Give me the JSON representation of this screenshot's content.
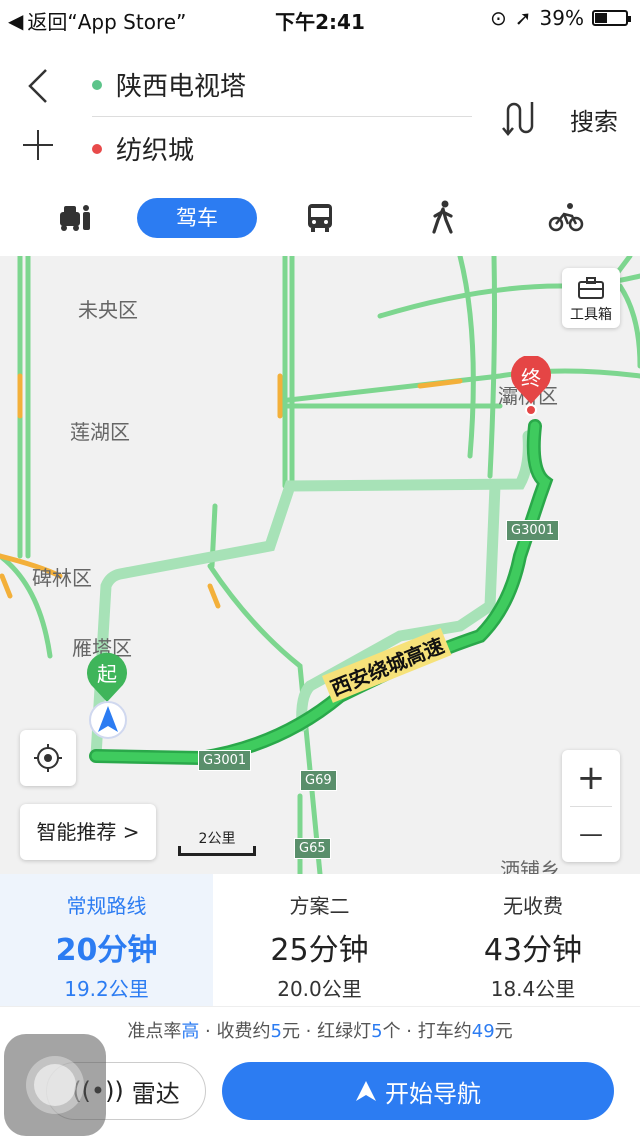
{
  "status_bar": {
    "back_label": "返回“App Store”",
    "time": "下午2:41",
    "battery": "39%",
    "battery_level": 0.39
  },
  "route": {
    "start": "陕西电视塔",
    "end": "纺织城",
    "search_label": "搜索",
    "start_color": "#5cc48a",
    "end_color": "#e84a4a"
  },
  "modes": {
    "taxi_icon": "taxi-icon",
    "drive_label": "驾车",
    "bus_icon": "bus-icon",
    "walk_icon": "walk-icon",
    "bike_icon": "bike-icon",
    "active_color": "#2c7cf2"
  },
  "map": {
    "districts": [
      "未央区",
      "莲湖区",
      "碑林区",
      "雁塔区",
      "灞桥区",
      "洒铺乡"
    ],
    "start_marker": "起",
    "end_marker": "终",
    "road_badges": [
      "G3001",
      "G3001",
      "G69",
      "G65"
    ],
    "highway_label": "西安绕城高速",
    "toolbox_label": "工具箱",
    "smart_label": "智能推荐 >",
    "scale_label": "2公里",
    "zoom_in": "+",
    "zoom_out": "—"
  },
  "routes": [
    {
      "name": "常规路线",
      "duration": "20分钟",
      "distance": "19.2公里"
    },
    {
      "name": "方案二",
      "duration": "25分钟",
      "distance": "20.0公里"
    },
    {
      "name": "无收费",
      "duration": "43分钟",
      "distance": "18.4公里"
    }
  ],
  "info": {
    "punctual_label": "准点率",
    "punctual_value": "高",
    "toll_label": " · 收费约",
    "toll_value": "5",
    "toll_unit": "元 · 红绿灯",
    "lights_value": "5",
    "lights_unit": "个 · 打车约",
    "taxi_value": "49",
    "taxi_unit": "元"
  },
  "actions": {
    "radar_label": "雷达",
    "navigate_label": "开始导航"
  }
}
